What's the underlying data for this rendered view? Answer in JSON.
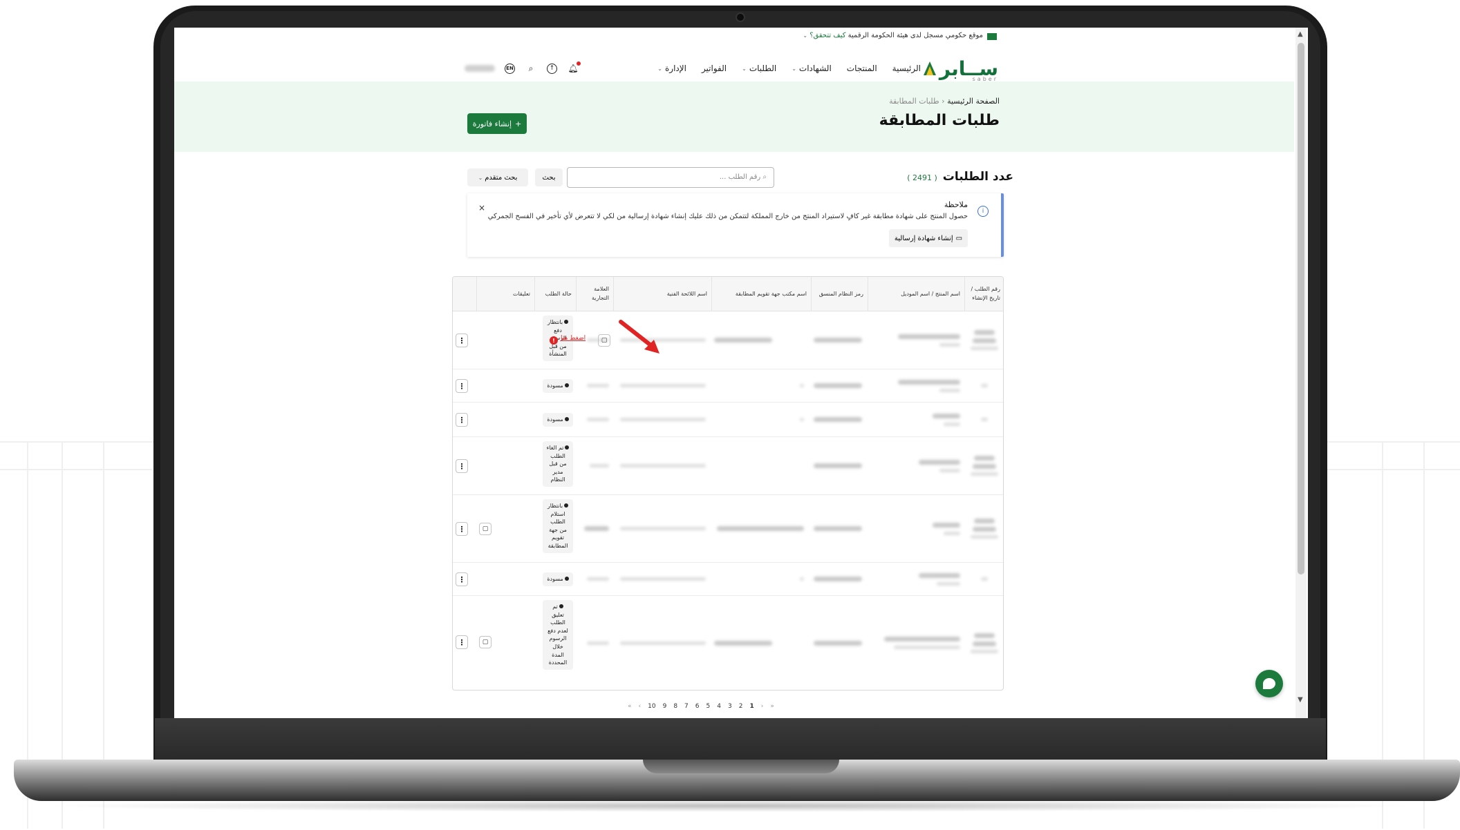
{
  "gov_bar": {
    "text": "موقع حكومي مسجل لدى هيئة الحكومة الرقمية",
    "link": "كيف تتحقق؟"
  },
  "logo": {
    "name": "ســابر",
    "sub": "saber"
  },
  "nav": {
    "items": [
      "الرئيسية",
      "المنتجات",
      "الشهادات",
      "الطلبات",
      "الفواتير",
      "الإدارة"
    ],
    "language_label": "EN"
  },
  "breadcrumb": {
    "home": "الصفحة الرئيسية",
    "current": "طلبات المطابقة"
  },
  "page_title": "طلبات المطابقة",
  "create_invoice_label": "إنشاء فاتورة",
  "count": {
    "label": "عدد الطلبات",
    "value": "( 2491 )"
  },
  "search": {
    "placeholder": "رقم الطلب ...",
    "button": "بحث",
    "advanced": "بحث متقدم"
  },
  "note": {
    "title": "ملاحظة",
    "text": "حصول المنتج على شهادة مطابقة غير كافٍ لاستيراد المنتج من خارج المملكة لتتمكن من ذلك عليك إنشاء شهادة إرسالية من لكي لا تتعرض لأي تأخير في الفسح الجمركي",
    "button": "إنشاء شهادة إرسالية",
    "close": "×"
  },
  "table": {
    "headers": [
      "رقم الطلب / تاريخ الإنشاء",
      "اسم المنتج / اسم الموديل",
      "رمز النظام المنسق",
      "اسم مكتب جهة تقويم المطابقة",
      "اسم اللائحة الفنية",
      "العلامة التجارية",
      "حالة الطلب",
      "تعليقات"
    ],
    "rows": [
      {
        "status": "بانتظار دفع الرسوم من قبل المنشأة",
        "click_here": "اضغط هنا"
      },
      {
        "status": "مسودة"
      },
      {
        "status": "مسودة"
      },
      {
        "status": "تم الغاء الطلب من قبل مدير النظام"
      },
      {
        "status": "بانتظار استلام الطلب من جهة تقويم المطابقة"
      },
      {
        "status": "مسودة"
      },
      {
        "status": "تم تعليق الطلب لعدم دفع الرسوم خلال المدة المحددة"
      }
    ]
  },
  "pagination": {
    "first": "«",
    "prev": "‹",
    "pages": [
      "10",
      "9",
      "8",
      "7",
      "6",
      "5",
      "4",
      "3",
      "2",
      "1"
    ],
    "next": "›",
    "last": "»"
  },
  "colors": {
    "brand": "#1b7a3c",
    "hero_bg": "#edf8f0",
    "alert": "#e02424",
    "note_border": "#6b8fd6"
  }
}
